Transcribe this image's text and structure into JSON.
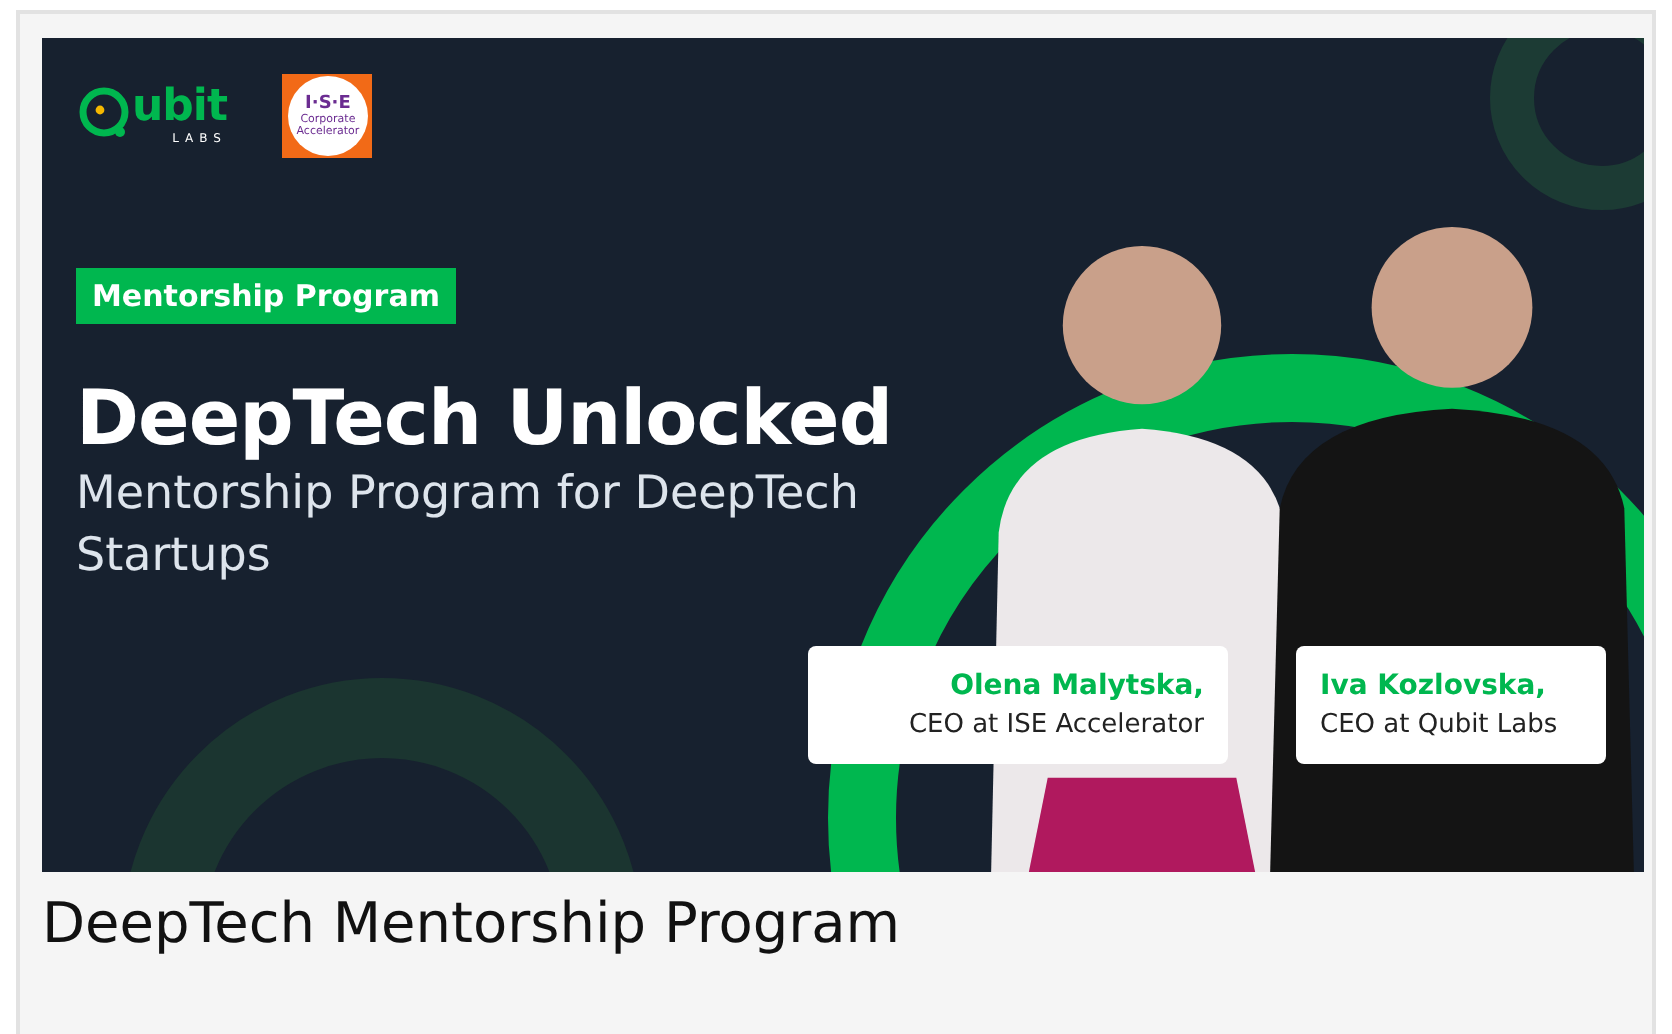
{
  "banner": {
    "logos": [
      {
        "kind": "qubit",
        "name": "ubit",
        "sub": "LABS"
      },
      {
        "kind": "ise",
        "name": "I·S·E",
        "sub": "Corporate Accelerator"
      }
    ],
    "tag": "Mentorship Program",
    "title": "DeepTech Unlocked",
    "subtitle": "Mentorship Program for DeepTech Startups",
    "people": [
      {
        "name": "Olena Malytska,",
        "role": "CEO at ISE Accelerator"
      },
      {
        "name": "Iva Kozlovska,",
        "role": "CEO at Qubit Labs"
      }
    ]
  },
  "caption": "DeepTech Mentorship Program"
}
